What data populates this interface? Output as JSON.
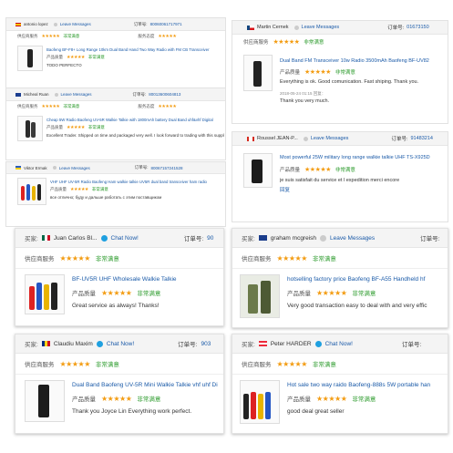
{
  "colors": {
    "star": "#f39c12",
    "link": "#1a5aa8",
    "satisfied": "#2a9a2a",
    "header_bg": "#f4f4f4"
  },
  "common": {
    "leave_messages": "Leave Messages",
    "chat_now": "Chat Now!",
    "order_label": "订单号:",
    "buyer_label": "买家:",
    "supplier_service": "供应商服务",
    "product_quality": "产品质量",
    "supplier_service_small": "服务态度",
    "stars": "★★★★★",
    "very_satisfied": "非常满意"
  },
  "left": [
    {
      "buyer": "antonio lopez",
      "order": "80060061717971",
      "product": "Baofeng BF-F8+ Long Range 10km Dual Band Hand Two Way Radio with FM CB Transceiver",
      "comment": "TODO PERFECTO"
    },
    {
      "buyer": "Micheal Ruan",
      "order": "80013600604813",
      "product": "Cheap 5W Radio Baofeng UV-5R Walkie Talkie with 1800mAh battery Dual Band uhf&vhf Digital",
      "comment": "Excellent Trader. Shipped on time and packaged very well. I look forward to trading with this supplier again."
    },
    {
      "buyer": "Viktor Ermak",
      "order": "80067157241528",
      "product": "VHF UHF UV-5R Radio Baofeng Ham walkie talkie UV5R dual band transceiver ham radio",
      "comment": "все отлично; буду и дальше работать с этим поставщиком"
    },
    {
      "buyer": "Juan Carlos Bl...",
      "order": "90",
      "product": "BF-UV5R UHF Wholesale Walkie Talkie",
      "comment": "Great service as always! Thanks!"
    },
    {
      "buyer": "Claudiu Maxim",
      "order": "903",
      "product": "Dual Band Baofeng UV-5R Mini Walkie Talkie vhf uhf Dig",
      "comment": "Thank you Joyce Lin Everything work perfect."
    }
  ],
  "right": [
    {
      "buyer": "Martin Cernek",
      "order": "01673150",
      "product": "Dual Band FM Transceiver 10w Radio 3500mAh Baofeng BF-UV82",
      "comment": "Everything is ok. Good comunication. Fast shiping. Thank you.",
      "reply_meta": "2018-05-24 01:15 回复：",
      "reply": "Thank you very much."
    },
    {
      "buyer": "Roussel JEAN-P...",
      "order": "91483214",
      "product": "Most powerful 25W military long range walkie talkie UHF TS-X925D",
      "comment": "je suis satisfait du service et l expedition merci encore",
      "reply": "回复"
    },
    {
      "buyer": "graham mcgreish",
      "order": "",
      "product": "hotselling factory price Baofeng BF-A55 Handheld hf",
      "comment": "Very good transaction easy to deal with and very effic"
    },
    {
      "buyer": "Peter HARDER",
      "order": "",
      "product": "Hot sale two way raido Baofeng-888s 5W portable han",
      "comment": "good deal great seller"
    }
  ]
}
